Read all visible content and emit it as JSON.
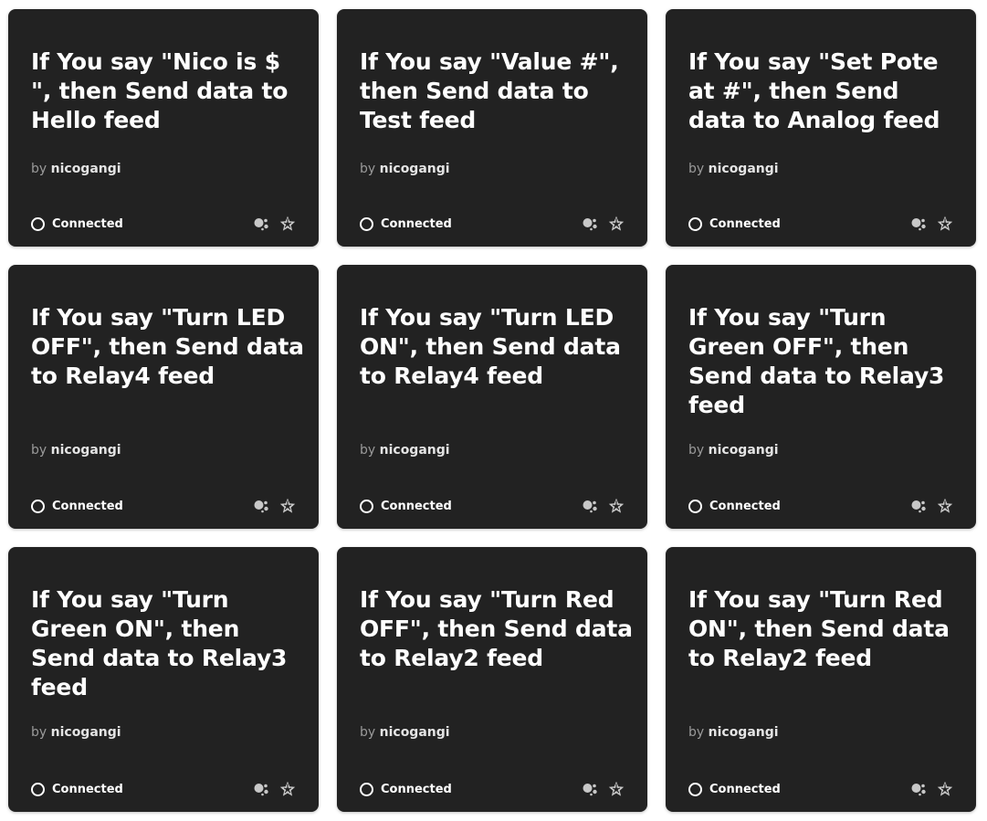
{
  "cards": [
    {
      "title": "If You say \"Nico is $ \", then Send data to Hello feed",
      "by_prefix": "by",
      "author": "nicogangi",
      "status": "Connected",
      "icons": [
        "google-assistant-icon",
        "adafruit-star-icon"
      ]
    },
    {
      "title": "If You say \"Value #\", then Send data to Test feed",
      "by_prefix": "by",
      "author": "nicogangi",
      "status": "Connected",
      "icons": [
        "google-assistant-icon",
        "adafruit-star-icon"
      ]
    },
    {
      "title": "If You say \"Set Pote at #\", then Send data to Analog feed",
      "by_prefix": "by",
      "author": "nicogangi",
      "status": "Connected",
      "icons": [
        "google-assistant-icon",
        "adafruit-star-icon"
      ]
    },
    {
      "title": "If You say \"Turn LED OFF\", then Send data to Relay4 feed",
      "by_prefix": "by",
      "author": "nicogangi",
      "status": "Connected",
      "icons": [
        "google-assistant-icon",
        "adafruit-star-icon"
      ]
    },
    {
      "title": "If You say \"Turn LED ON\", then Send data to Relay4 feed",
      "by_prefix": "by",
      "author": "nicogangi",
      "status": "Connected",
      "icons": [
        "google-assistant-icon",
        "adafruit-star-icon"
      ]
    },
    {
      "title": "If You say \"Turn Green OFF\", then Send data to Relay3 feed",
      "by_prefix": "by",
      "author": "nicogangi",
      "status": "Connected",
      "icons": [
        "google-assistant-icon",
        "adafruit-star-icon"
      ]
    },
    {
      "title": "If You say \"Turn Green ON\", then Send data to Relay3 feed",
      "by_prefix": "by",
      "author": "nicogangi",
      "status": "Connected",
      "icons": [
        "google-assistant-icon",
        "adafruit-star-icon"
      ]
    },
    {
      "title": "If You say \"Turn Red OFF\", then Send data to Relay2 feed",
      "by_prefix": "by",
      "author": "nicogangi",
      "status": "Connected",
      "icons": [
        "google-assistant-icon",
        "adafruit-star-icon"
      ]
    },
    {
      "title": "If You say \"Turn Red ON\", then Send data to Relay2 feed",
      "by_prefix": "by",
      "author": "nicogangi",
      "status": "Connected",
      "icons": [
        "google-assistant-icon",
        "adafruit-star-icon"
      ]
    }
  ],
  "colors": {
    "card_background": "#222222",
    "title_text": "#ffffff",
    "byline_prefix": "#9a9a9a",
    "author_text": "#e4e4e4",
    "icon_gray": "#c8c8c8"
  }
}
